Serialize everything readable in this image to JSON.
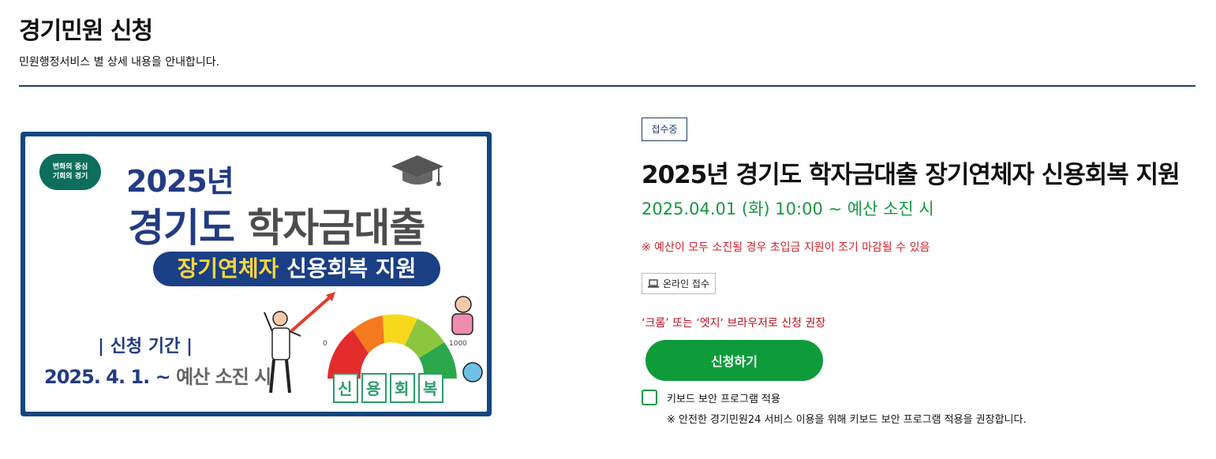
{
  "header": {
    "title": "경기민원 신청",
    "subtitle": "민원행정서비스 별 상세 내용을 안내합니다."
  },
  "banner": {
    "badge_line1": "변화의 중심",
    "badge_line2": "기회의 경기",
    "year": "2025년",
    "title_part1": "경기도",
    "title_part2": "학자금대출",
    "pill_part1": "장기연체자",
    "pill_part2": "신용회복 지원",
    "period_label": "| 신청 기간 |",
    "period_part1": "2025. 4. 1. ~",
    "period_part2": "예산 소진 시",
    "gauge_min": "0",
    "gauge_max": "1000",
    "gauge_tiles": [
      "신",
      "용",
      "회",
      "복"
    ]
  },
  "detail": {
    "status": "접수중",
    "title": "2025년 경기도 학자금대출 장기연체자 신용회복 지원",
    "period": "2025.04.01 (화) 10:00 ~ 예산 소진 시",
    "notice": "※ 예산이 모두 소진될 경우 초입금 지원이 조기 마감될 수 있음",
    "online_label": "온라인 접수",
    "browser_note": "‘크롬’ 또는 ‘엣지‘ 브라우저로 신청 권장",
    "apply_label": "신청하기",
    "keyboard_label": "키보드 보안 프로그램 적용",
    "keyboard_note": "※ 안전한 경기민원24 서비스 이용을 위해 키보드 보안 프로그램 적용을 권장합니다."
  },
  "colors": {
    "navy": "#1f3e6e",
    "green": "#0e9c3b",
    "red": "#d4222b"
  }
}
